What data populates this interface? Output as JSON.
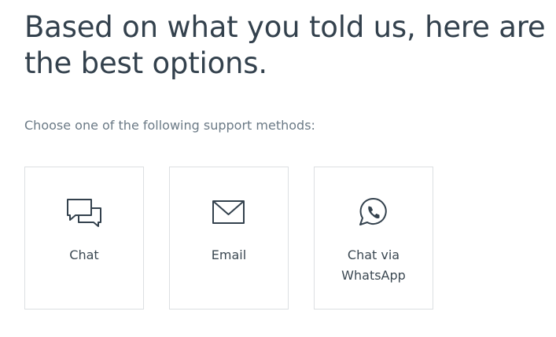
{
  "page": {
    "heading": "Based on what you told us, here are the best options.",
    "subtext": "Choose one of the following support methods:"
  },
  "options": [
    {
      "label": "Chat",
      "icon": "chat-bubbles-icon"
    },
    {
      "label": "Email",
      "icon": "envelope-icon"
    },
    {
      "label": "Chat via\nWhatsApp",
      "icon": "whatsapp-icon"
    }
  ],
  "colors": {
    "text": "#33414d",
    "muted_text": "#6b7a86",
    "card_border": "#dcdfe2",
    "icon_stroke": "#33414d"
  }
}
